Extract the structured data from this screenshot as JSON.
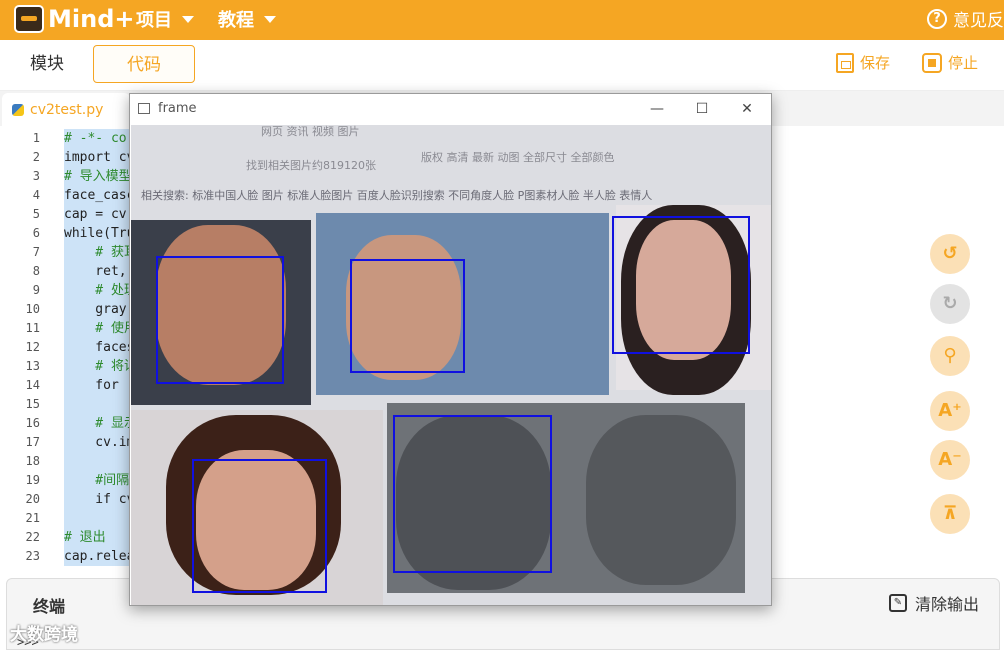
{
  "app": {
    "logo_text": "Mind+"
  },
  "menu": {
    "items": [
      {
        "label": "项目"
      },
      {
        "label": "教程"
      }
    ],
    "help_label": "意见反"
  },
  "tabs": {
    "blocks": "模块",
    "code": "代码"
  },
  "toolbar": {
    "save": "保存",
    "stop": "停止"
  },
  "file_tab": {
    "name": "cv2test.py"
  },
  "editor": {
    "lines": [
      {
        "num": "1",
        "text": "# -*- co"
      },
      {
        "num": "2",
        "text": "import cv"
      },
      {
        "num": "3",
        "text": "# 导入模型"
      },
      {
        "num": "4",
        "text": "face_casc"
      },
      {
        "num": "5",
        "text": "cap = cv"
      },
      {
        "num": "6",
        "text": "while(Tru"
      },
      {
        "num": "7",
        "text": "    # 获耳"
      },
      {
        "num": "8",
        "text": "    ret,"
      },
      {
        "num": "9",
        "text": "    # 处理"
      },
      {
        "num": "10",
        "text": "    gray"
      },
      {
        "num": "11",
        "text": "    # 使用"
      },
      {
        "num": "12",
        "text": "    faces"
      },
      {
        "num": "13",
        "text": "    # 将识"
      },
      {
        "num": "14",
        "text": "    for "
      },
      {
        "num": "15",
        "text": "        "
      },
      {
        "num": "16",
        "text": "    # 显示"
      },
      {
        "num": "17",
        "text": "    cv.im"
      },
      {
        "num": "18",
        "text": "    "
      },
      {
        "num": "19",
        "text": "    #间隔"
      },
      {
        "num": "20",
        "text": "    if cv"
      },
      {
        "num": "21",
        "text": "        "
      },
      {
        "num": "22",
        "text": "# 退出 "
      },
      {
        "num": "23",
        "text": "cap.relea"
      }
    ]
  },
  "window": {
    "title": "frame",
    "controls": {
      "minimize": "—",
      "maximize": "☐",
      "close": "✕"
    },
    "photo": {
      "nav": "网页   资讯   视频   图片",
      "stats": "找到相关图片约819120张",
      "filters": "版权   高清   最新   动图   全部尺寸   全部颜色",
      "related": "相关搜索:  标准中国人脸 图片    标准人脸图片    百度人脸识别搜索    不同角度人脸    P图素材人脸    半人脸    表情人"
    },
    "detections": 5
  },
  "terminal": {
    "title": "终端",
    "clear_label": "清除输出",
    "prompt": ">>>"
  },
  "watermark": "大数跨境",
  "colors": {
    "accent": "#f5a623",
    "detection_box": "#1010e0",
    "code_highlight": "#cde3f7"
  },
  "side_icons": [
    "undo-icon",
    "redo-icon",
    "zoom-icon",
    "font-increase-icon",
    "font-decrease-icon",
    "scroll-top-icon"
  ]
}
